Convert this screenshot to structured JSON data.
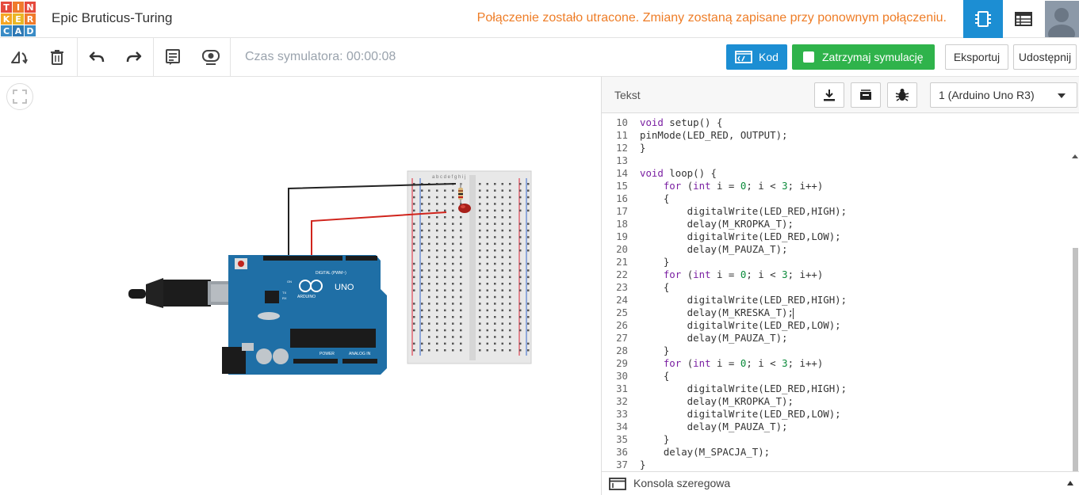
{
  "app": {
    "logo_letters": [
      "T",
      "I",
      "N",
      "K",
      "E",
      "R",
      "C",
      "A",
      "D"
    ],
    "project_title": "Epic Bruticus-Turing",
    "connection_message": "Połączenie zostało utracone. Zmiany zostaną zapisane przy ponownym połączeniu."
  },
  "toolbar": {
    "sim_time": "Czas symulatora: 00:00:08",
    "code_label": "Kod",
    "stop_label": "Zatrzymaj symulację",
    "export_label": "Eksportuj",
    "share_label": "Udostępnij"
  },
  "canvas": {
    "board_label": "UNO",
    "board_brand": "ARDUINO",
    "digital_label": "DIGITAL (PWM~)",
    "power_label": "POWER",
    "analog_label": "ANALOG IN",
    "on_label": "ON",
    "tx_label": "TX",
    "rx_label": "RX",
    "breadboard_cols_top": "a b c d e   f g h i j"
  },
  "code_panel": {
    "mode_label": "Tekst",
    "device_select": "1 (Arduino Uno R3)",
    "console_label": "Konsola szeregowa",
    "lines": [
      {
        "n": "10",
        "t": "void setup() {"
      },
      {
        "n": "11",
        "t": "pinMode(LED_RED, OUTPUT);"
      },
      {
        "n": "12",
        "t": "}"
      },
      {
        "n": "13",
        "t": ""
      },
      {
        "n": "14",
        "t": "void loop() {"
      },
      {
        "n": "15",
        "t": "    for (int i = 0; i < 3; i++)"
      },
      {
        "n": "16",
        "t": "    {"
      },
      {
        "n": "17",
        "t": "        digitalWrite(LED_RED,HIGH);"
      },
      {
        "n": "18",
        "t": "        delay(M_KROPKA_T);"
      },
      {
        "n": "19",
        "t": "        digitalWrite(LED_RED,LOW);"
      },
      {
        "n": "20",
        "t": "        delay(M_PAUZA_T);"
      },
      {
        "n": "21",
        "t": "    }"
      },
      {
        "n": "22",
        "t": "    for (int i = 0; i < 3; i++)"
      },
      {
        "n": "23",
        "t": "    {"
      },
      {
        "n": "24",
        "t": "        digitalWrite(LED_RED,HIGH);"
      },
      {
        "n": "25",
        "t": "        delay(M_KRESKA_T);"
      },
      {
        "n": "26",
        "t": "        digitalWrite(LED_RED,LOW);"
      },
      {
        "n": "27",
        "t": "        delay(M_PAUZA_T);"
      },
      {
        "n": "28",
        "t": "    }"
      },
      {
        "n": "29",
        "t": "    for (int i = 0; i < 3; i++)"
      },
      {
        "n": "30",
        "t": "    {"
      },
      {
        "n": "31",
        "t": "        digitalWrite(LED_RED,HIGH);"
      },
      {
        "n": "32",
        "t": "        delay(M_KROPKA_T);"
      },
      {
        "n": "33",
        "t": "        digitalWrite(LED_RED,LOW);"
      },
      {
        "n": "34",
        "t": "        delay(M_PAUZA_T);"
      },
      {
        "n": "35",
        "t": "    }"
      },
      {
        "n": "36",
        "t": "    delay(M_SPACJA_T);"
      },
      {
        "n": "37",
        "t": "}"
      }
    ]
  },
  "colors": {
    "accent_blue": "#1c8ed3",
    "stop_green": "#2fb34b",
    "warning_orange": "#ee7d27",
    "arduino_blue": "#1f6fa6",
    "led_red": "#c0241c"
  },
  "icons": {
    "rotate": "rotate-icon",
    "delete": "trash-icon",
    "undo": "undo-icon",
    "redo": "redo-icon",
    "notes": "notes-icon",
    "view": "eye-icon",
    "circuit": "chip-icon",
    "components_list": "table-icon",
    "download": "download-icon",
    "library": "library-icon",
    "debug": "bug-icon"
  }
}
